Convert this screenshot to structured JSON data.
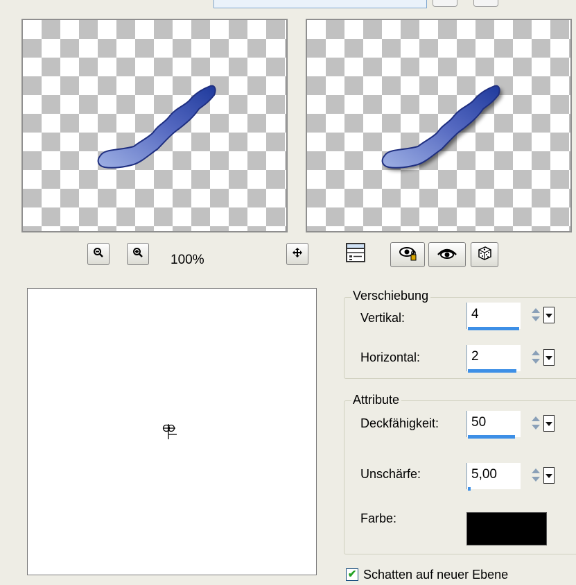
{
  "preview": {
    "zoom_level": "100%",
    "icons": {
      "zoom_out": "zoom-out-icon",
      "zoom_in": "zoom-in-icon",
      "pan": "move-icon",
      "proof": "proof-icon",
      "reset": "reset-icon",
      "eye": "eye-icon",
      "random": "dice-icon"
    }
  },
  "colors": {
    "stroke_light": "#9eb0e4",
    "stroke_dark": "#1f3a9c",
    "shadow_color": "#000000",
    "spin_bar": "#3d8fe6"
  },
  "offset_group": {
    "title": "Verschiebung",
    "vertical_label": "Vertikal:",
    "vertical_value": "4",
    "horizontal_label": "Horizontal:",
    "horizontal_value": "2"
  },
  "attributes_group": {
    "title": "Attribute",
    "opacity_label": "Deckfähigkeit:",
    "opacity_value": "50",
    "blur_label": "Unschärfe:",
    "blur_value": "5,00",
    "color_label": "Farbe:",
    "color_value": "#000000"
  },
  "shadow_on_new_layer": {
    "label": "Schatten auf neuer Ebene",
    "checked": true
  }
}
